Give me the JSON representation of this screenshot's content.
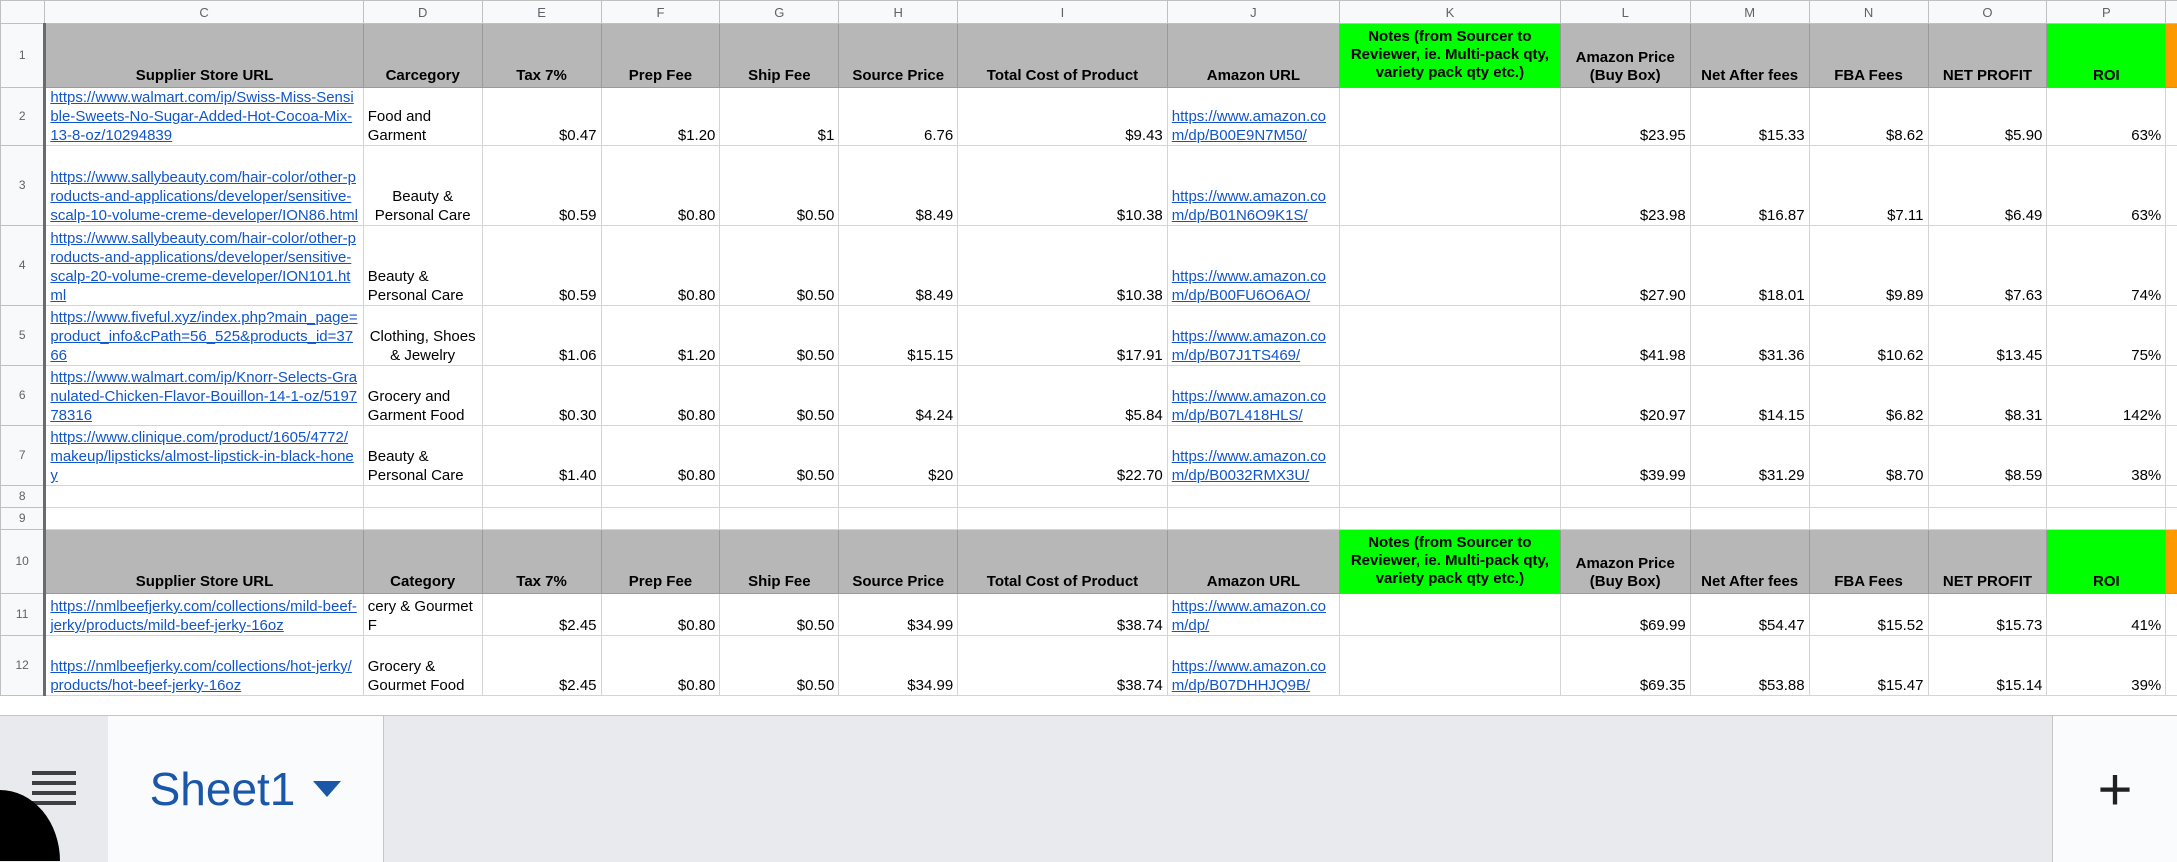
{
  "columns": [
    "C",
    "D",
    "E",
    "F",
    "G",
    "H",
    "I",
    "J",
    "K",
    "L",
    "M",
    "N",
    "O",
    "P"
  ],
  "header": {
    "supplier": "Supplier Store URL",
    "category1": "Carcegory",
    "category2": "Category",
    "tax": "Tax 7%",
    "prep": "Prep Fee",
    "ship": "Ship Fee",
    "source": "Source Price",
    "total": "Total Cost of Product",
    "amazon_url": "Amazon URL",
    "notes": "Notes (from Sourcer to Reviewer, ie. Multi-pack qty, variety pack qty etc.)",
    "amazon_price": "Amazon Price (Buy Box)",
    "net_after": "Net After fees",
    "fba": "FBA Fees",
    "net_profit": "NET PROFIT",
    "roi": "ROI"
  },
  "rows": [
    {
      "n": "2",
      "supplier": "https://www.walmart.com/ip/Swiss-Miss-Sensible-Sweets-No-Sugar-Added-Hot-Cocoa-Mix-13-8-oz/10294839",
      "category": "Food and Garment",
      "tax": "$0.47",
      "prep": "$1.20",
      "ship": "$1",
      "source": "6.76",
      "total": "$9.43",
      "amazon": "https://www.amazon.com/dp/B00E9N7M50/",
      "notes": "",
      "price": "$23.95",
      "net": "$15.33",
      "fba": "$8.62",
      "profit": "$5.90",
      "roi": "63%"
    },
    {
      "n": "3",
      "supplier": "https://www.sallybeauty.com/hair-color/other-products-and-applications/developer/sensitive-scalp-10-volume-creme-developer/ION86.html",
      "category": "Beauty & Personal Care",
      "tax": "$0.59",
      "prep": "$0.80",
      "ship": "$0.50",
      "source": "$8.49",
      "total": "$10.38",
      "amazon": "https://www.amazon.com/dp/B01N6O9K1S/",
      "notes": "",
      "price": "$23.98",
      "net": "$16.87",
      "fba": "$7.11",
      "profit": "$6.49",
      "roi": "63%"
    },
    {
      "n": "4",
      "supplier": "https://www.sallybeauty.com/hair-color/other-products-and-applications/developer/sensitive-scalp-20-volume-creme-developer/ION101.html",
      "category": "Beauty & Personal Care",
      "tax": "$0.59",
      "prep": "$0.80",
      "ship": "$0.50",
      "source": "$8.49",
      "total": "$10.38",
      "amazon": "https://www.amazon.com/dp/B00FU6O6AO/",
      "notes": "",
      "price": "$27.90",
      "net": "$18.01",
      "fba": "$9.89",
      "profit": "$7.63",
      "roi": "74%"
    },
    {
      "n": "5",
      "supplier": "https://www.fiveful.xyz/index.php?main_page=product_info&cPath=56_525&products_id=3766",
      "category": "Clothing, Shoes & Jewelry",
      "tax": "$1.06",
      "prep": "$1.20",
      "ship": "$0.50",
      "source": "$15.15",
      "total": "$17.91",
      "amazon": "https://www.amazon.com/dp/B07J1TS469/",
      "notes": "",
      "price": "$41.98",
      "net": "$31.36",
      "fba": "$10.62",
      "profit": "$13.45",
      "roi": "75%"
    },
    {
      "n": "6",
      "supplier": "https://www.walmart.com/ip/Knorr-Selects-Granulated-Chicken-Flavor-Bouillon-14-1-oz/519778316",
      "category": "Grocery and Garment Food",
      "tax": "$0.30",
      "prep": "$0.80",
      "ship": "$0.50",
      "source": "$4.24",
      "total": "$5.84",
      "amazon": "https://www.amazon.com/dp/B07L418HLS/",
      "notes": "",
      "price": "$20.97",
      "net": "$14.15",
      "fba": "$6.82",
      "profit": "$8.31",
      "roi": "142%"
    },
    {
      "n": "7",
      "supplier": "https://www.clinique.com/product/1605/4772/makeup/lipsticks/almost-lipstick-in-black-honey",
      "category": "Beauty & Personal Care",
      "tax": "$1.40",
      "prep": "$0.80",
      "ship": "$0.50",
      "source": "$20",
      "total": "$22.70",
      "amazon": "https://www.amazon.com/dp/B0032RMX3U/",
      "notes": "",
      "price": "$39.99",
      "net": "$31.29",
      "fba": "$8.70",
      "profit": "$8.59",
      "roi": "38%"
    }
  ],
  "rows2": [
    {
      "n": "11",
      "supplier": "https://nmlbeefjerky.com/collections/mild-beef-jerky/products/mild-beef-jerky-16oz",
      "category": "cery & Gourmet F",
      "tax": "$2.45",
      "prep": "$0.80",
      "ship": "$0.50",
      "source": "$34.99",
      "total": "$38.74",
      "amazon": "https://www.amazon.com/dp/",
      "notes": "",
      "price": "$69.99",
      "net": "$54.47",
      "fba": "$15.52",
      "profit": "$15.73",
      "roi": "41%"
    },
    {
      "n": "12",
      "supplier": "https://nmlbeefjerky.com/collections/hot-jerky/products/hot-beef-jerky-16oz",
      "category": "Grocery & Gourmet Food",
      "tax": "$2.45",
      "prep": "$0.80",
      "ship": "$0.50",
      "source": "$34.99",
      "total": "$38.74",
      "amazon": "https://www.amazon.com/dp/B07DHHJQ9B/",
      "notes": "",
      "price": "$69.35",
      "net": "$53.88",
      "fba": "$15.47",
      "profit": "$15.14",
      "roi": "39%"
    }
  ],
  "row_numbers": {
    "r1": "1",
    "r8": "8",
    "r9": "9",
    "r10": "10"
  },
  "sheet_tab": "Sheet1",
  "add_sheet": "+",
  "colors": {
    "header_gray": "#b7b7b7",
    "notes_green": "#00ff00",
    "roi_green": "#00ff00",
    "accent_orange": "#ff9900",
    "link_blue": "#1155cc",
    "tab_blue": "#1a57a8"
  },
  "icons": {
    "menu": "hamburger-menu-icon",
    "caret": "caret-down-icon",
    "add": "plus-icon"
  }
}
